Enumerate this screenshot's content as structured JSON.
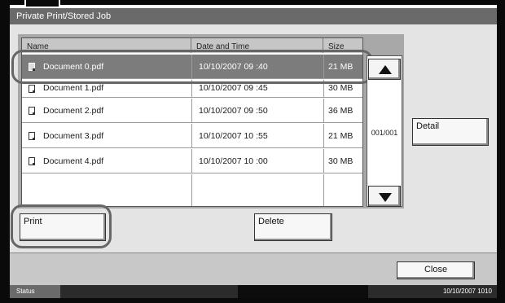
{
  "window": {
    "title": "Private Print/Stored Job"
  },
  "table": {
    "headers": {
      "name": "Name",
      "date": "Date and Time",
      "size": "Size"
    },
    "rows": [
      {
        "name": "Document 0.pdf",
        "date": "10/10/2007 09 :40",
        "size": "21 MB",
        "selected": true
      },
      {
        "name": "Document 1.pdf",
        "date": "10/10/2007 09 :45",
        "size": "30 MB",
        "selected": false
      },
      {
        "name": "Document 2.pdf",
        "date": "10/10/2007 09 :50",
        "size": "36 MB",
        "selected": false
      },
      {
        "name": "Document 3.pdf",
        "date": "10/10/2007 10 :55",
        "size": "21 MB",
        "selected": false
      },
      {
        "name": "Document 4.pdf",
        "date": "10/10/2007 10 :00",
        "size": "30 MB",
        "selected": false
      }
    ]
  },
  "pagination": {
    "page": "001/001"
  },
  "buttons": {
    "detail": "Detail",
    "print": "Print",
    "delete": "Delete",
    "close": "Close"
  },
  "status_bar": {
    "label": "Status",
    "datetime": "10/10/2007   1010"
  },
  "icons": {
    "scroll_up": "triangle-up-icon",
    "scroll_down": "triangle-down-icon",
    "file": "document-icon"
  }
}
